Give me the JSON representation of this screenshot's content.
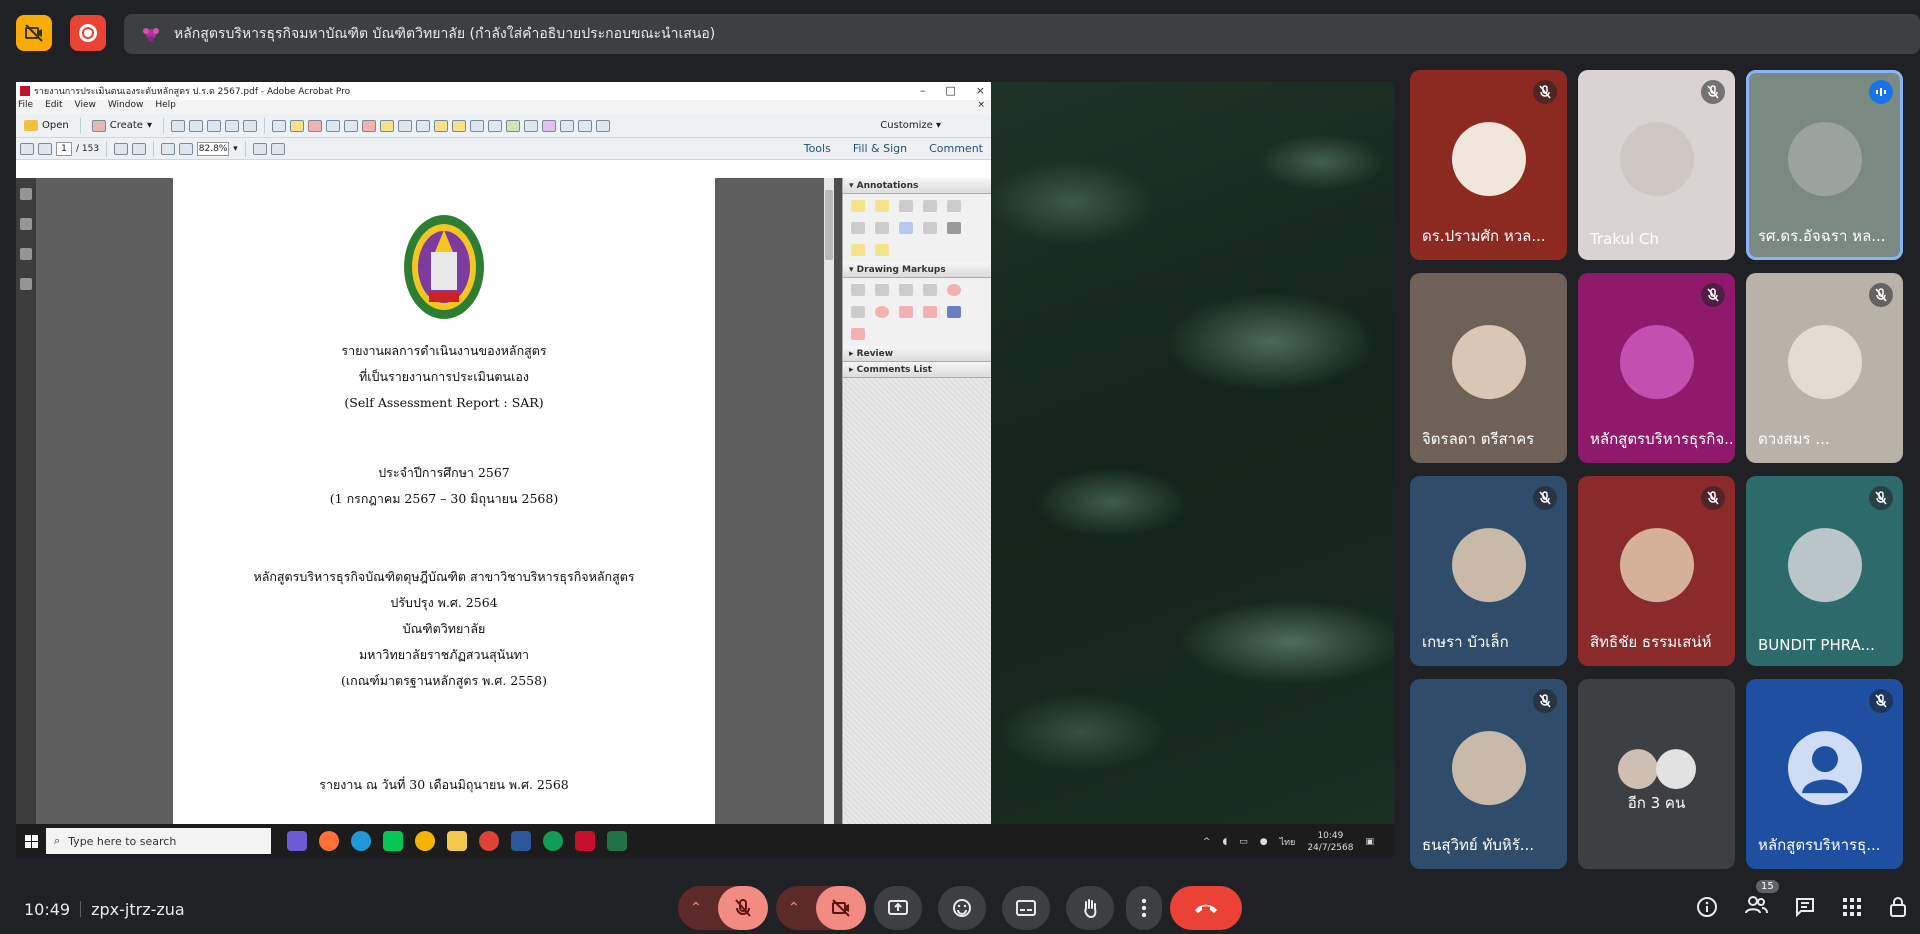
{
  "topbar": {
    "presenting_title": "หลักสูตรบริหารธุรกิจมหาบัณฑิต บัณฑิตวิทยาลัย (กำลังใส่คำอธิบายประกอบขณะนำเสนอ)"
  },
  "acrobat": {
    "window_title": "รายงานการประเมินตนเองระดับหลักสูตร ป.ร.ด 2567.pdf - Adobe Acrobat Pro",
    "menu": [
      "File",
      "Edit",
      "View",
      "Window",
      "Help"
    ],
    "open_label": "Open",
    "create_label": "Create",
    "customize_label": "Customize",
    "page_current": "1",
    "page_total": "/ 153",
    "zoom": "82.8%",
    "right_links": [
      "Tools",
      "Fill & Sign",
      "Comment"
    ],
    "panel": {
      "annotations": "Annotations",
      "drawing": "Drawing Markups",
      "review": "Review",
      "comments_list": "Comments List"
    }
  },
  "document": {
    "line1": "รายงานผลการดำเนินงานของหลักสูตร",
    "line2": "ที่เป็นรายงานการประเมินตนเอง",
    "line3": "(Self Assessment Report : SAR)",
    "line4": "ประจำปีการศึกษา 2567",
    "line5": "(1 กรกฎาคม 2567 – 30 มิถุนายน 2568)",
    "line6": "หลักสูตรบริหารธุรกิจบัณฑิตดุษฎีบัณฑิต สาขาวิชาบริหารธุรกิจหลักสูตร",
    "line7": "ปรับปรุง พ.ศ. 2564",
    "line8": "บัณฑิตวิทยาลัย",
    "line9": "มหาวิทยาลัยราชภัฏสวนสุนันทา",
    "line10": "(เกณฑ์มาตรฐานหลักสูตร พ.ศ. 2558)",
    "line11": "รายงาน ณ วันที่ 30 เดือนมิถุนายน พ.ศ. 2568"
  },
  "taskbar": {
    "search_placeholder": "Type here to search",
    "time": "10:49",
    "date": "24/7/2568",
    "lang": "ไทย"
  },
  "participants": [
    {
      "name": "ดร.ปรามศัก หวล...",
      "muted": true,
      "bg": "#8c2a22"
    },
    {
      "name": "Trakul Ch",
      "muted": true,
      "bg": "#d9d4d2"
    },
    {
      "name": "รศ.ดร.อัจฉรา หล...",
      "muted": false,
      "bg": "#7a8a80"
    },
    {
      "name": "จิตรลดา ตรีสาคร",
      "muted": false,
      "bg": "#6e6258"
    },
    {
      "name": "หลักสูตรบริหารธุรกิจ...",
      "muted": true,
      "bg": "#8f1a6c"
    },
    {
      "name": "ดวงสมร ...",
      "muted": true,
      "bg": "#b9b2a8"
    },
    {
      "name": "เกษรา บัวเล็ก",
      "muted": true,
      "bg": "#2f4d6a"
    },
    {
      "name": "สิทธิชัย ธรรมเสน่ห์",
      "muted": true,
      "bg": "#8b2a2a"
    },
    {
      "name": "BUNDIT PHRA...",
      "muted": true,
      "bg": "#2d6a6a"
    },
    {
      "name": "ธนสุวิทย์ ทับหิรั...",
      "muted": true,
      "bg": "#2f4d6a"
    },
    {
      "name": "อีก 3 คน",
      "muted": false,
      "bg": "#3c4043"
    },
    {
      "name": "หลักสูตรบริหารธุ...",
      "muted": true,
      "bg": "#1e4fa0"
    }
  ],
  "bottombar": {
    "time": "10:49",
    "meeting_code": "zpx-jtrz-zua",
    "people_count": "15"
  },
  "colors": {
    "accent_blue": "#8ab4f8",
    "leave_red": "#ea4335",
    "muted_red": "#f28b82"
  }
}
